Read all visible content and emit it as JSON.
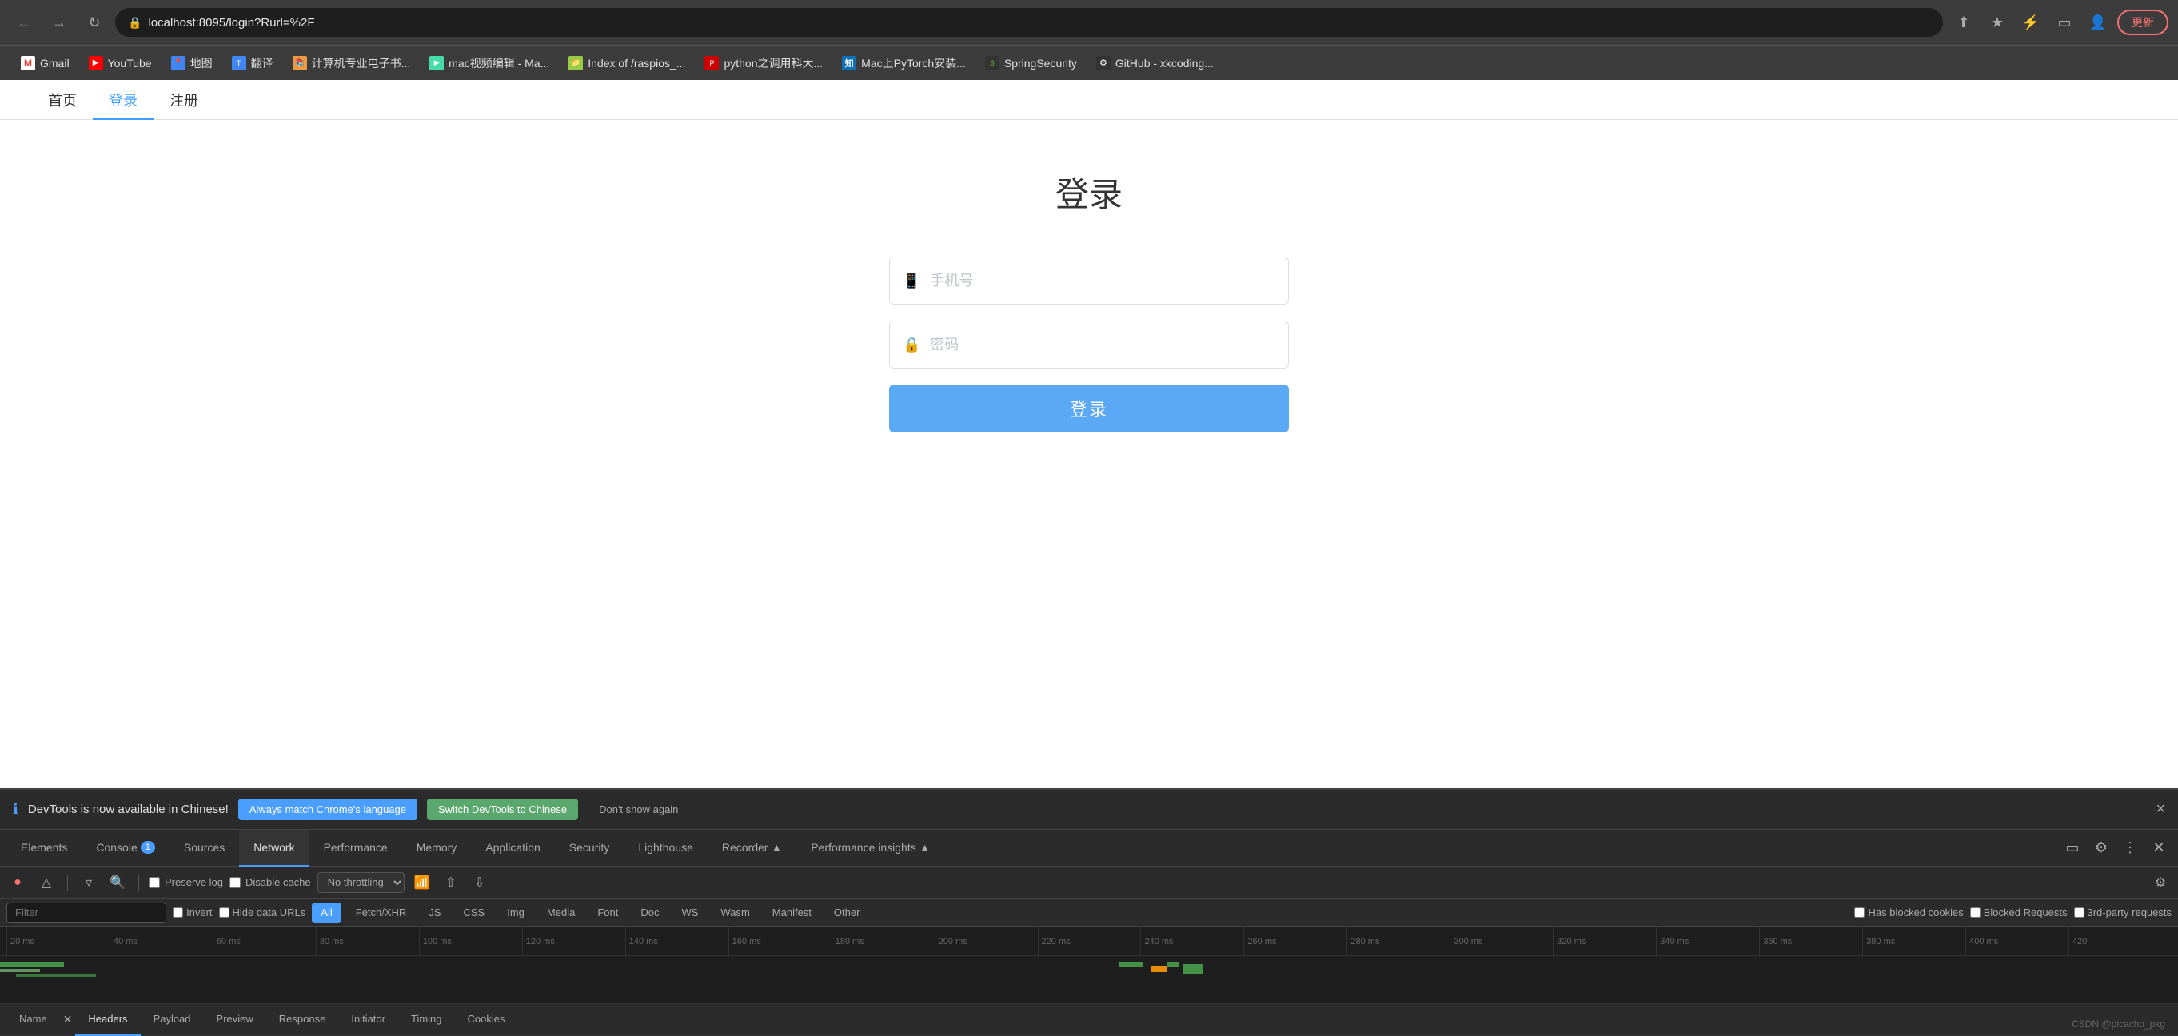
{
  "browser": {
    "url": "localhost:8095/login?Rurl=%2F",
    "back_btn": "←",
    "forward_btn": "→",
    "reload_btn": "↻",
    "update_btn": "更新",
    "bookmarks": [
      {
        "label": "Gmail",
        "favicon_char": "M",
        "favicon_class": "favicon-gmail"
      },
      {
        "label": "YouTube",
        "favicon_char": "▶",
        "favicon_class": "favicon-youtube"
      },
      {
        "label": "地图",
        "favicon_char": "📍",
        "favicon_class": "favicon-maps"
      },
      {
        "label": "翻译",
        "favicon_char": "T",
        "favicon_class": "favicon-translate"
      },
      {
        "label": "计算机专业电子书...",
        "favicon_char": "📚",
        "favicon_class": "favicon-book"
      },
      {
        "label": "mac视频编辑 - Ma...",
        "favicon_char": "▶",
        "favicon_class": "favicon-mac"
      },
      {
        "label": "Index of /raspios_...",
        "favicon_char": "📁",
        "favicon_class": "favicon-index"
      },
      {
        "label": "python之调用科大...",
        "favicon_char": "P",
        "favicon_class": "favicon-python"
      },
      {
        "label": "Mac上PyTorch安装...",
        "favicon_char": "知",
        "favicon_class": "favicon-zhihu"
      },
      {
        "label": "SpringSecurity",
        "favicon_char": "S",
        "favicon_class": "favicon-spring"
      },
      {
        "label": "GitHub - xkcoding...",
        "favicon_char": "⚙",
        "favicon_class": "favicon-github"
      }
    ]
  },
  "page_nav": {
    "items": [
      {
        "label": "首页",
        "active": false
      },
      {
        "label": "登录",
        "active": true
      },
      {
        "label": "注册",
        "active": false
      }
    ]
  },
  "login_form": {
    "title": "登录",
    "phone_placeholder": "手机号",
    "password_placeholder": "密码",
    "submit_label": "登录"
  },
  "devtools": {
    "notification": {
      "icon": "ℹ",
      "text": "DevTools is now available in Chinese!",
      "btn1": "Always match Chrome's language",
      "btn2": "Switch DevTools to Chinese",
      "btn3": "Don't show again",
      "close": "×"
    },
    "tabs": [
      {
        "label": "Elements",
        "active": false
      },
      {
        "label": "Console",
        "active": false
      },
      {
        "label": "Sources",
        "active": false
      },
      {
        "label": "Network",
        "active": true
      },
      {
        "label": "Performance",
        "active": false
      },
      {
        "label": "Memory",
        "active": false
      },
      {
        "label": "Application",
        "active": false
      },
      {
        "label": "Security",
        "active": false
      },
      {
        "label": "Lighthouse",
        "active": false
      },
      {
        "label": "Recorder ▲",
        "active": false
      },
      {
        "label": "Performance insights ▲",
        "active": false
      }
    ],
    "toolbar": {
      "preserve_log_label": "Preserve log",
      "disable_cache_label": "Disable cache",
      "throttle_label": "No throttling"
    },
    "filter": {
      "placeholder": "Filter",
      "invert_label": "Invert",
      "hide_data_urls_label": "Hide data URLs",
      "type_btns": [
        "All",
        "Fetch/XHR",
        "JS",
        "CSS",
        "Img",
        "Media",
        "Font",
        "Doc",
        "WS",
        "Wasm",
        "Manifest",
        "Other"
      ],
      "has_blocked_label": "Has blocked cookies",
      "blocked_requests_label": "Blocked Requests",
      "third_party_label": "3rd-party requests"
    },
    "timeline": {
      "marks": [
        "20 ms",
        "40 ms",
        "60 ms",
        "80 ms",
        "100 ms",
        "120 ms",
        "140 ms",
        "160 ms",
        "180 ms",
        "200 ms",
        "220 ms",
        "240 ms",
        "260 ms",
        "280 ms",
        "300 ms",
        "320 ms",
        "340 ms",
        "360 ms",
        "380 ms",
        "400 ms",
        "420"
      ]
    },
    "panel_tabs": [
      {
        "label": "Name",
        "active": false,
        "has_close": false
      },
      {
        "label": "Headers",
        "active": true,
        "has_close": true
      },
      {
        "label": "Payload",
        "active": false,
        "has_close": false
      },
      {
        "label": "Preview",
        "active": false,
        "has_close": false
      },
      {
        "label": "Response",
        "active": false,
        "has_close": false
      },
      {
        "label": "Initiator",
        "active": false,
        "has_close": false
      },
      {
        "label": "Timing",
        "active": false,
        "has_close": false
      },
      {
        "label": "Cookies",
        "active": false,
        "has_close": false
      }
    ],
    "console_badge": "1",
    "watermark": "CSDN @picacho_pkg"
  }
}
